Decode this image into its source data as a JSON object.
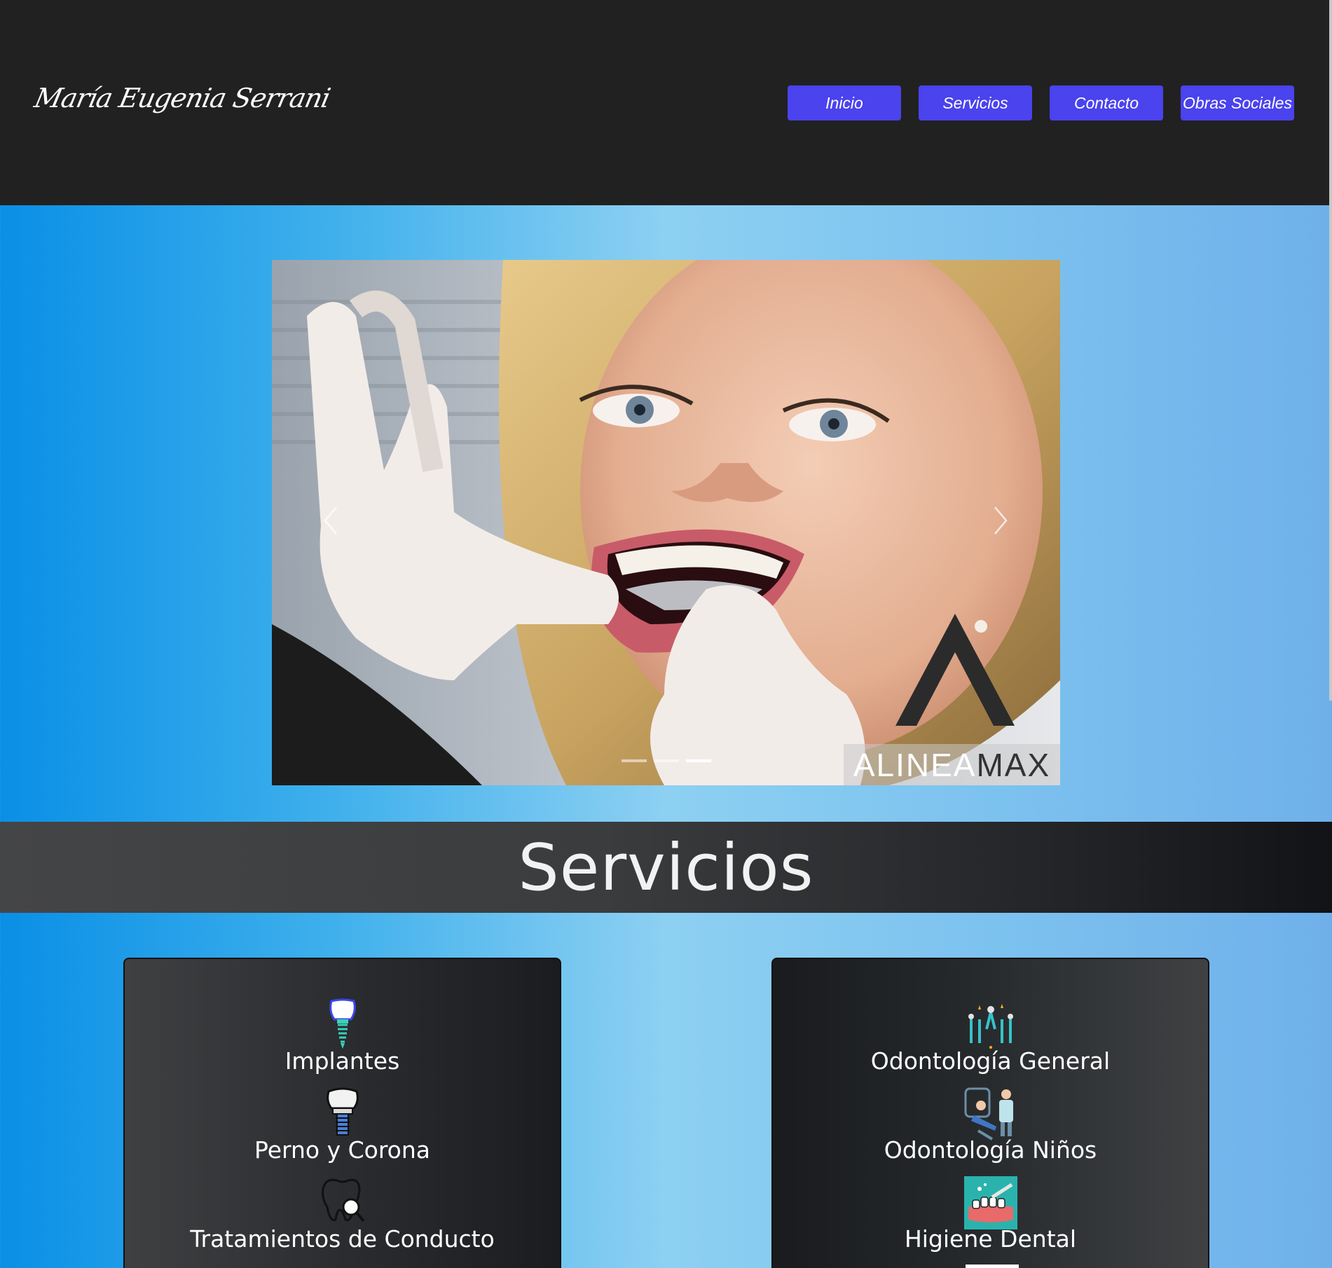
{
  "header": {
    "logo_text": "María Eugenia Serrani",
    "nav": [
      {
        "label": "Inicio"
      },
      {
        "label": "Servicios"
      },
      {
        "label": "Contacto"
      },
      {
        "label": "Obras Sociales"
      }
    ]
  },
  "carousel": {
    "brand_part1": "ALINEA",
    "brand_part2": "MAX",
    "slide_count": 3,
    "active_slide": 3
  },
  "services": {
    "title": "Servicios",
    "left": [
      {
        "label": "Implantes",
        "icon": "dental-implant-icon"
      },
      {
        "label": "Perno y Corona",
        "icon": "crown-implant-icon"
      },
      {
        "label": "Tratamientos de Conducto",
        "icon": "tooth-magnifier-icon"
      }
    ],
    "right": [
      {
        "label": "Odontología General",
        "icon": "dental-tools-icon"
      },
      {
        "label": "Odontología Niños",
        "icon": "dentist-chair-icon"
      },
      {
        "label": "Higiene Dental",
        "icon": "teeth-brushing-icon"
      }
    ]
  },
  "colors": {
    "header_bg": "#212121",
    "nav_button": "#4a43ee",
    "band_dark": "#3a3c3e"
  }
}
